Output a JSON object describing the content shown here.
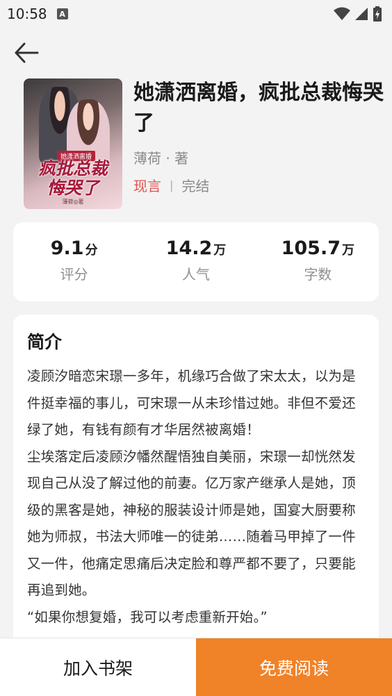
{
  "status_bar": {
    "time": "10:58",
    "notification_icon": "A",
    "icons": [
      "wifi-icon",
      "signal-icon",
      "battery-icon"
    ]
  },
  "header": {
    "back_icon": "arrow-left-icon"
  },
  "book": {
    "cover": {
      "badge": "她潇洒离婚",
      "title_line1": "疯批总裁",
      "title_line2": "悔哭了",
      "author": "薄荷◎著"
    },
    "title": "她潇洒离婚，疯批总裁悔哭了",
    "author": "薄荷 · 著",
    "genre": "现言",
    "separator": "|",
    "status": "完结"
  },
  "stats": [
    {
      "value": "9.1",
      "unit": "分",
      "label": "评分"
    },
    {
      "value": "14.2",
      "unit": "万",
      "label": "人气"
    },
    {
      "value": "105.7",
      "unit": "万",
      "label": "字数"
    }
  ],
  "intro": {
    "heading": "简介",
    "body": "凌顾汐暗恋宋璟一多年，机缘巧合做了宋太太，以为是件挺幸福的事儿，可宋璟一从未珍惜过她。非但不爱还绿了她，有钱有颜有才华居然被离婚！\n尘埃落定后凌顾汐幡然醒悟独自美丽，宋璟一却恍然发现自己从没了解过他的前妻。亿万家产继承人是她，顶级的黑客是她，神秘的服装设计师是她，国宴大厨要称她为师叔，书法大师唯一的徒弟……随着马甲掉了一件又一件，他痛定思痛后决定脸和尊严都不要了，只要能再追到她。\n“如果你想复婚，我可以考虑重新开始。”"
  },
  "actions": {
    "add_shelf_label": "加入书架",
    "free_read_label": "免费阅读"
  },
  "colors": {
    "accent": "#f08228",
    "genre": "#e0524d",
    "background": "#f3f3f3"
  }
}
